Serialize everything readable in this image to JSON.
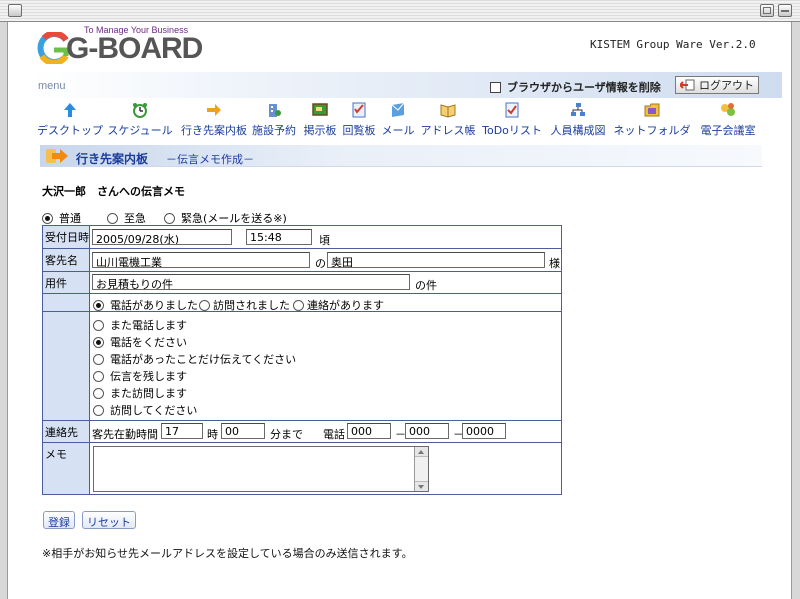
{
  "header": {
    "logo_tagline": "To Manage Your Business",
    "logo_text": "G-BOARD",
    "version": "KISTEM Group Ware Ver.2.0"
  },
  "menu": {
    "label": "menu",
    "browser_clear_label": "ブラウザからユーザ情報を削除",
    "logout_label": "ログアウト"
  },
  "nav": {
    "items": [
      {
        "label": "デスクトップ",
        "icon": "desktop-arrow-icon"
      },
      {
        "label": "スケジュール",
        "icon": "clock-icon"
      },
      {
        "label": "行き先案内板",
        "icon": "arrow-right-icon"
      },
      {
        "label": "施設予約",
        "icon": "building-icon"
      },
      {
        "label": "掲示板",
        "icon": "board-icon"
      },
      {
        "label": "回覧板",
        "icon": "checklist-icon"
      },
      {
        "label": "メール",
        "icon": "mail-icon"
      },
      {
        "label": "アドレス帳",
        "icon": "address-book-icon"
      },
      {
        "label": "ToDoリスト",
        "icon": "todo-icon"
      },
      {
        "label": "人員構成図",
        "icon": "org-chart-icon"
      },
      {
        "label": "ネットフォルダ",
        "icon": "folder-icon"
      },
      {
        "label": "電子会議室",
        "icon": "meeting-icon"
      }
    ]
  },
  "section": {
    "title": "行き先案内板",
    "subtitle": "－伝言メモ作成－"
  },
  "page": {
    "heading": "大沢一郎　さんへの伝言メモ",
    "priority_options": [
      "普通",
      "至急",
      "緊急(メールを送る※)"
    ],
    "priority_selected": "普通"
  },
  "form": {
    "received": {
      "label": "受付日時",
      "date": "2005/09/28(水)",
      "time": "15:48",
      "suffix": "頃"
    },
    "customer": {
      "label": "客先名",
      "company": "山川電機工業",
      "connector": "の",
      "person": "奥田",
      "honorific": "様"
    },
    "subject": {
      "label": "用件",
      "value": "お見積もりの件",
      "suffix": "の件"
    },
    "contact_type": {
      "options": [
        "電話がありました",
        "訪問されました",
        "連絡があります"
      ],
      "selected": "電話がありました"
    },
    "action": {
      "options": [
        "また電話します",
        "電話をください",
        "電話があったことだけ伝えてください",
        "伝言を残します",
        "また訪問します",
        "訪問してください"
      ],
      "selected": "電話をください"
    },
    "contact": {
      "label": "連絡先",
      "office_hours_label": "客先在勤時間",
      "hour": "17",
      "hour_unit": "時",
      "minute": "00",
      "minute_suffix": "分まで",
      "phone_label": "電話",
      "phone1": "000",
      "phone2": "000",
      "phone3": "0000",
      "dash": "－"
    },
    "memo": {
      "label": "メモ",
      "value": ""
    }
  },
  "buttons": {
    "register": "登録",
    "reset": "リセット"
  },
  "footnote": "※相手がお知らせ先メールアドレスを設定している場合のみ送信されます。"
}
